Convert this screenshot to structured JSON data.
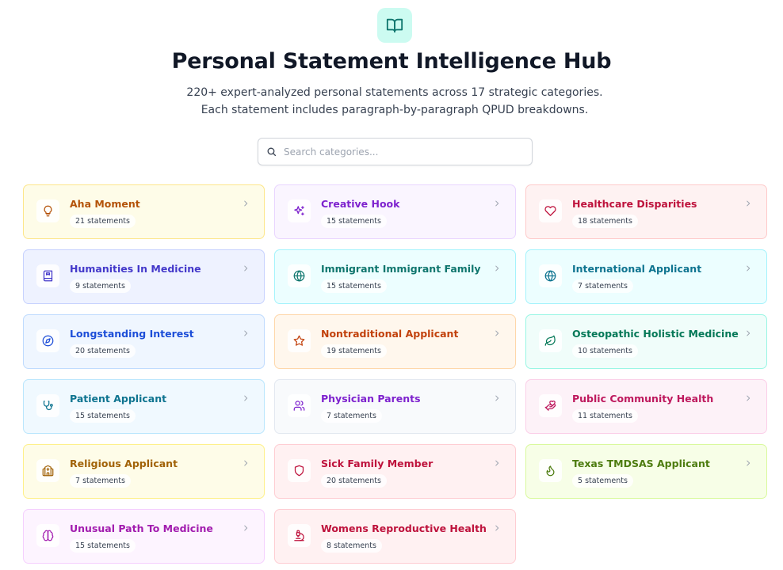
{
  "header": {
    "icon": "book-open-icon",
    "title": "Personal Statement Intelligence Hub",
    "subtitle": "220+ expert-analyzed personal statements across 17 strategic categories. Each statement includes paragraph-by-paragraph QPUD breakdowns."
  },
  "search": {
    "icon": "search-icon",
    "placeholder": "Search categories..."
  },
  "categories": [
    {
      "name": "Aha Moment",
      "count": "21 statements",
      "icon": "lightbulb-icon",
      "bg": "#fefce8",
      "border": "#fde68a",
      "color": "#b45309"
    },
    {
      "name": "Creative Hook",
      "count": "15 statements",
      "icon": "sparkles-icon",
      "bg": "#faf5ff",
      "border": "#e9d5ff",
      "color": "#7e22ce"
    },
    {
      "name": "Healthcare Disparities",
      "count": "18 statements",
      "icon": "heart-icon",
      "bg": "#fef2f2",
      "border": "#fecaca",
      "color": "#be123c"
    },
    {
      "name": "Humanities In Medicine",
      "count": "9 statements",
      "icon": "book-icon",
      "bg": "#eef2ff",
      "border": "#c7d2fe",
      "color": "#4338ca"
    },
    {
      "name": "Immigrant Immigrant Family",
      "count": "15 statements",
      "icon": "globe-icon",
      "bg": "#ecfeff",
      "border": "#a5f3fc",
      "color": "#0f766e"
    },
    {
      "name": "International Applicant",
      "count": "7 statements",
      "icon": "globe-icon",
      "bg": "#ecfeff",
      "border": "#a5f3fc",
      "color": "#0e7490"
    },
    {
      "name": "Longstanding Interest",
      "count": "20 statements",
      "icon": "compass-icon",
      "bg": "#eff6ff",
      "border": "#bfdbfe",
      "color": "#1d4ed8"
    },
    {
      "name": "Nontraditional Applicant",
      "count": "19 statements",
      "icon": "star-icon",
      "bg": "#fff7ed",
      "border": "#fed7aa",
      "color": "#c2410c"
    },
    {
      "name": "Osteopathic Holistic Medicine",
      "count": "10 statements",
      "icon": "leaf-icon",
      "bg": "#f0fdfa",
      "border": "#99f6e4",
      "color": "#047857"
    },
    {
      "name": "Patient Applicant",
      "count": "15 statements",
      "icon": "stethoscope-icon",
      "bg": "#f0f9ff",
      "border": "#bae6fd",
      "color": "#0e7490"
    },
    {
      "name": "Physician Parents",
      "count": "7 statements",
      "icon": "users-icon",
      "bg": "#f8fafc",
      "border": "#e2e8f0",
      "color": "#7e22ce"
    },
    {
      "name": "Public Community Health",
      "count": "11 statements",
      "icon": "hand-heart-icon",
      "bg": "#fdf2f8",
      "border": "#fbcfe8",
      "color": "#be185d"
    },
    {
      "name": "Religious Applicant",
      "count": "7 statements",
      "icon": "church-icon",
      "bg": "#fefce8",
      "border": "#fef08a",
      "color": "#a16207"
    },
    {
      "name": "Sick Family Member",
      "count": "20 statements",
      "icon": "shield-icon",
      "bg": "#fff1f2",
      "border": "#fecdd3",
      "color": "#be123c"
    },
    {
      "name": "Texas TMDSAS Applicant",
      "count": "5 statements",
      "icon": "flame-icon",
      "bg": "#f7fee7",
      "border": "#d9f99d",
      "color": "#4d7c0f"
    },
    {
      "name": "Unusual Path To Medicine",
      "count": "15 statements",
      "icon": "brain-icon",
      "bg": "#fdf4ff",
      "border": "#f5d0fe",
      "color": "#a21caf"
    },
    {
      "name": "Womens Reproductive Health",
      "count": "8 statements",
      "icon": "microscope-icon",
      "bg": "#fff1f2",
      "border": "#fecdd3",
      "color": "#be123c"
    }
  ]
}
